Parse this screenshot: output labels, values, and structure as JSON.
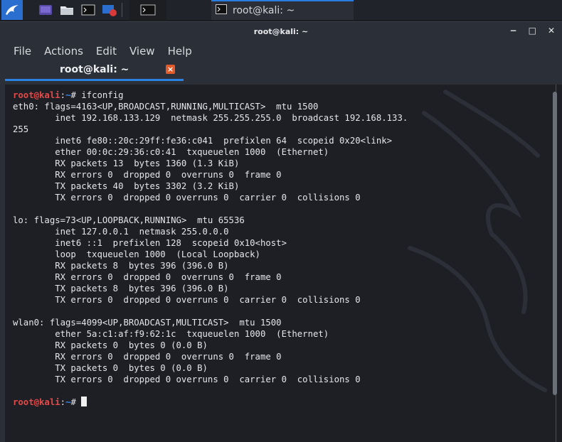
{
  "taskbar": {
    "task_title": "root@kali: ~",
    "icons": [
      "kali-menu-icon",
      "workspace-icon",
      "file-manager-icon",
      "terminal-icon",
      "screen-recorder-icon"
    ]
  },
  "window": {
    "title": "root@kali: ~",
    "controls": {
      "minimize": "−",
      "maximize": "□",
      "close": "✕"
    }
  },
  "menubar": {
    "file": "File",
    "actions": "Actions",
    "edit": "Edit",
    "view": "View",
    "help": "Help"
  },
  "tab": {
    "title": "root@kali: ~",
    "close": "×"
  },
  "prompt": {
    "user": "root",
    "at": "@",
    "host": "kali",
    "sep": ":",
    "dir": "~",
    "sym": "#"
  },
  "command": " ifconfig",
  "output": [
    "eth0: flags=4163<UP,BROADCAST,RUNNING,MULTICAST>  mtu 1500",
    "        inet 192.168.133.129  netmask 255.255.255.0  broadcast 192.168.133.",
    "255",
    "        inet6 fe80::20c:29ff:fe36:c041  prefixlen 64  scopeid 0x20<link>",
    "        ether 00:0c:29:36:c0:41  txqueuelen 1000  (Ethernet)",
    "        RX packets 13  bytes 1360 (1.3 KiB)",
    "        RX errors 0  dropped 0  overruns 0  frame 0",
    "        TX packets 40  bytes 3302 (3.2 KiB)",
    "        TX errors 0  dropped 0 overruns 0  carrier 0  collisions 0",
    "",
    "lo: flags=73<UP,LOOPBACK,RUNNING>  mtu 65536",
    "        inet 127.0.0.1  netmask 255.0.0.0",
    "        inet6 ::1  prefixlen 128  scopeid 0x10<host>",
    "        loop  txqueuelen 1000  (Local Loopback)",
    "        RX packets 8  bytes 396 (396.0 B)",
    "        RX errors 0  dropped 0  overruns 0  frame 0",
    "        TX packets 8  bytes 396 (396.0 B)",
    "        TX errors 0  dropped 0 overruns 0  carrier 0  collisions 0",
    "",
    "wlan0: flags=4099<UP,BROADCAST,MULTICAST>  mtu 1500",
    "        ether 5a:c1:af:f9:62:1c  txqueuelen 1000  (Ethernet)",
    "        RX packets 0  bytes 0 (0.0 B)",
    "        RX errors 0  dropped 0  overruns 0  frame 0",
    "        TX packets 0  bytes 0 (0.0 B)",
    "        TX errors 0  dropped 0 overruns 0  carrier 0  collisions 0",
    ""
  ],
  "colors": {
    "prompt_user": "#e24a4a",
    "prompt_path": "#3c84e4",
    "accent": "#2a82e4"
  }
}
